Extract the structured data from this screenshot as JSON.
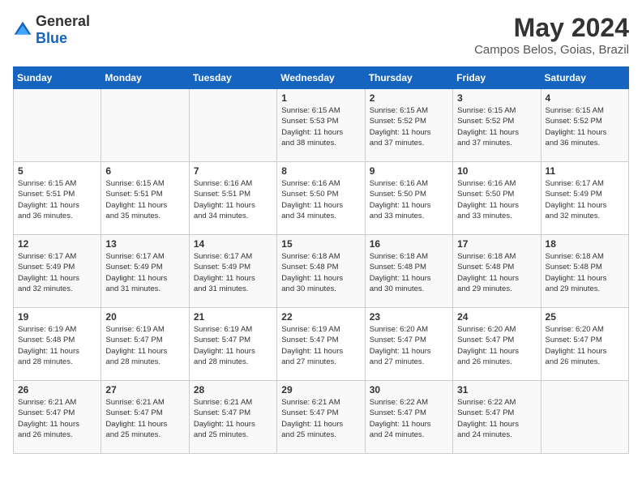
{
  "header": {
    "logo_general": "General",
    "logo_blue": "Blue",
    "month_title": "May 2024",
    "location": "Campos Belos, Goias, Brazil"
  },
  "weekdays": [
    "Sunday",
    "Monday",
    "Tuesday",
    "Wednesday",
    "Thursday",
    "Friday",
    "Saturday"
  ],
  "weeks": [
    [
      {
        "day": "",
        "info": ""
      },
      {
        "day": "",
        "info": ""
      },
      {
        "day": "",
        "info": ""
      },
      {
        "day": "1",
        "info": "Sunrise: 6:15 AM\nSunset: 5:53 PM\nDaylight: 11 hours\nand 38 minutes."
      },
      {
        "day": "2",
        "info": "Sunrise: 6:15 AM\nSunset: 5:52 PM\nDaylight: 11 hours\nand 37 minutes."
      },
      {
        "day": "3",
        "info": "Sunrise: 6:15 AM\nSunset: 5:52 PM\nDaylight: 11 hours\nand 37 minutes."
      },
      {
        "day": "4",
        "info": "Sunrise: 6:15 AM\nSunset: 5:52 PM\nDaylight: 11 hours\nand 36 minutes."
      }
    ],
    [
      {
        "day": "5",
        "info": "Sunrise: 6:15 AM\nSunset: 5:51 PM\nDaylight: 11 hours\nand 36 minutes."
      },
      {
        "day": "6",
        "info": "Sunrise: 6:15 AM\nSunset: 5:51 PM\nDaylight: 11 hours\nand 35 minutes."
      },
      {
        "day": "7",
        "info": "Sunrise: 6:16 AM\nSunset: 5:51 PM\nDaylight: 11 hours\nand 34 minutes."
      },
      {
        "day": "8",
        "info": "Sunrise: 6:16 AM\nSunset: 5:50 PM\nDaylight: 11 hours\nand 34 minutes."
      },
      {
        "day": "9",
        "info": "Sunrise: 6:16 AM\nSunset: 5:50 PM\nDaylight: 11 hours\nand 33 minutes."
      },
      {
        "day": "10",
        "info": "Sunrise: 6:16 AM\nSunset: 5:50 PM\nDaylight: 11 hours\nand 33 minutes."
      },
      {
        "day": "11",
        "info": "Sunrise: 6:17 AM\nSunset: 5:49 PM\nDaylight: 11 hours\nand 32 minutes."
      }
    ],
    [
      {
        "day": "12",
        "info": "Sunrise: 6:17 AM\nSunset: 5:49 PM\nDaylight: 11 hours\nand 32 minutes."
      },
      {
        "day": "13",
        "info": "Sunrise: 6:17 AM\nSunset: 5:49 PM\nDaylight: 11 hours\nand 31 minutes."
      },
      {
        "day": "14",
        "info": "Sunrise: 6:17 AM\nSunset: 5:49 PM\nDaylight: 11 hours\nand 31 minutes."
      },
      {
        "day": "15",
        "info": "Sunrise: 6:18 AM\nSunset: 5:48 PM\nDaylight: 11 hours\nand 30 minutes."
      },
      {
        "day": "16",
        "info": "Sunrise: 6:18 AM\nSunset: 5:48 PM\nDaylight: 11 hours\nand 30 minutes."
      },
      {
        "day": "17",
        "info": "Sunrise: 6:18 AM\nSunset: 5:48 PM\nDaylight: 11 hours\nand 29 minutes."
      },
      {
        "day": "18",
        "info": "Sunrise: 6:18 AM\nSunset: 5:48 PM\nDaylight: 11 hours\nand 29 minutes."
      }
    ],
    [
      {
        "day": "19",
        "info": "Sunrise: 6:19 AM\nSunset: 5:48 PM\nDaylight: 11 hours\nand 28 minutes."
      },
      {
        "day": "20",
        "info": "Sunrise: 6:19 AM\nSunset: 5:47 PM\nDaylight: 11 hours\nand 28 minutes."
      },
      {
        "day": "21",
        "info": "Sunrise: 6:19 AM\nSunset: 5:47 PM\nDaylight: 11 hours\nand 28 minutes."
      },
      {
        "day": "22",
        "info": "Sunrise: 6:19 AM\nSunset: 5:47 PM\nDaylight: 11 hours\nand 27 minutes."
      },
      {
        "day": "23",
        "info": "Sunrise: 6:20 AM\nSunset: 5:47 PM\nDaylight: 11 hours\nand 27 minutes."
      },
      {
        "day": "24",
        "info": "Sunrise: 6:20 AM\nSunset: 5:47 PM\nDaylight: 11 hours\nand 26 minutes."
      },
      {
        "day": "25",
        "info": "Sunrise: 6:20 AM\nSunset: 5:47 PM\nDaylight: 11 hours\nand 26 minutes."
      }
    ],
    [
      {
        "day": "26",
        "info": "Sunrise: 6:21 AM\nSunset: 5:47 PM\nDaylight: 11 hours\nand 26 minutes."
      },
      {
        "day": "27",
        "info": "Sunrise: 6:21 AM\nSunset: 5:47 PM\nDaylight: 11 hours\nand 25 minutes."
      },
      {
        "day": "28",
        "info": "Sunrise: 6:21 AM\nSunset: 5:47 PM\nDaylight: 11 hours\nand 25 minutes."
      },
      {
        "day": "29",
        "info": "Sunrise: 6:21 AM\nSunset: 5:47 PM\nDaylight: 11 hours\nand 25 minutes."
      },
      {
        "day": "30",
        "info": "Sunrise: 6:22 AM\nSunset: 5:47 PM\nDaylight: 11 hours\nand 24 minutes."
      },
      {
        "day": "31",
        "info": "Sunrise: 6:22 AM\nSunset: 5:47 PM\nDaylight: 11 hours\nand 24 minutes."
      },
      {
        "day": "",
        "info": ""
      }
    ]
  ]
}
